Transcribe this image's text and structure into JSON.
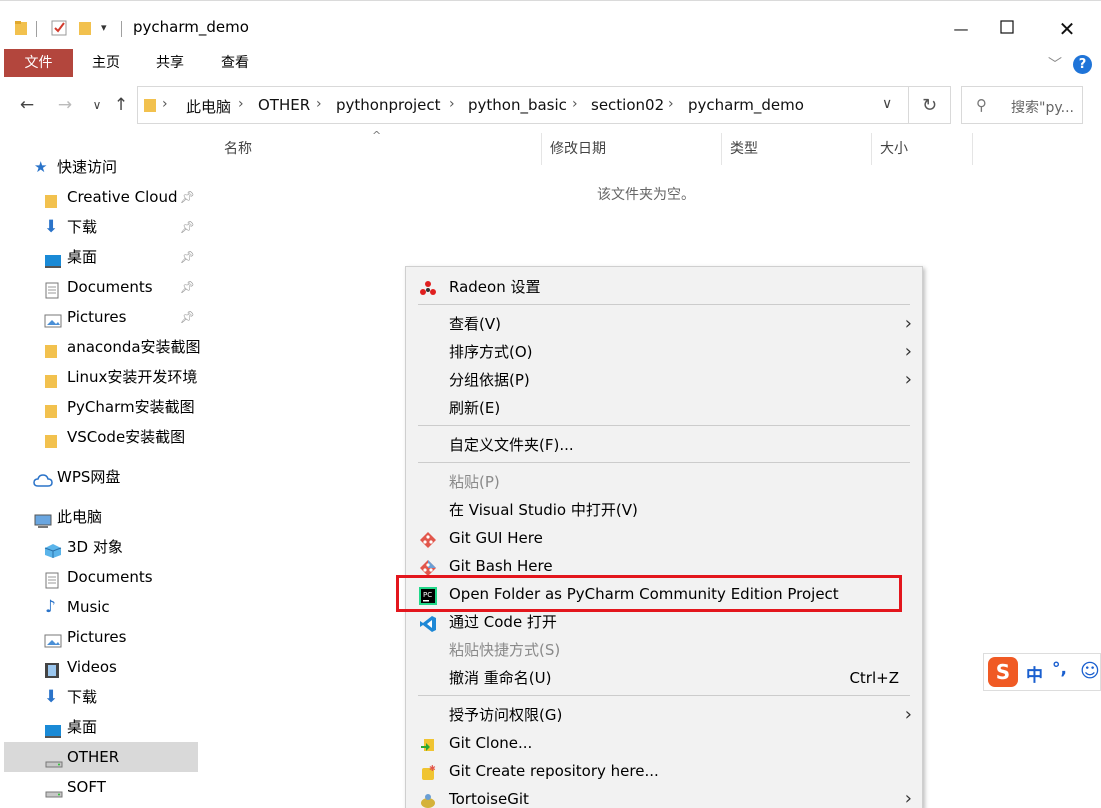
{
  "window": {
    "title": "pycharm_demo",
    "minimize_icon": "minimize-icon",
    "maximize_icon": "maximize-icon",
    "close_icon": "close-icon"
  },
  "ribbon": {
    "tabs": [
      "文件",
      "主页",
      "共享",
      "查看"
    ],
    "help_icon": "help-icon",
    "expand_icon": "chevron-down-icon"
  },
  "address": {
    "breadcrumbs": [
      "此电脑",
      "OTHER",
      "pythonproject",
      "python_basic",
      "section02",
      "pycharm_demo"
    ],
    "search_placeholder": "搜索\"py..."
  },
  "columns": [
    "名称",
    "修改日期",
    "类型",
    "大小"
  ],
  "empty_message": "该文件夹为空。",
  "sidebar": {
    "quick_access": "快速访问",
    "quick_items": [
      "Creative Cloud",
      "下载",
      "桌面",
      "Documents",
      "Pictures",
      "anaconda安装截图",
      "Linux安装开发环境",
      "PyCharm安装截图",
      "VSCode安装截图"
    ],
    "wps": "WPS网盘",
    "this_pc": "此电脑",
    "pc_items": [
      "3D 对象",
      "Documents",
      "Music",
      "Pictures",
      "Videos",
      "下载",
      "桌面",
      "OTHER",
      "SOFT"
    ]
  },
  "context_menu": {
    "radeon": "Radeon 设置",
    "view": "查看(V)",
    "sort": "排序方式(O)",
    "group": "分组依据(P)",
    "refresh": "刷新(E)",
    "customize": "自定义文件夹(F)...",
    "paste": "粘贴(P)",
    "open_vs": "在 Visual Studio 中打开(V)",
    "git_gui": "Git GUI Here",
    "git_bash": "Git Bash Here",
    "pycharm": "Open Folder as PyCharm Community Edition Project",
    "vscode": "通过 Code 打开",
    "paste_shortcut": "粘贴快捷方式(S)",
    "undo": "撤消 重命名(U)",
    "undo_accel": "Ctrl+Z",
    "grant": "授予访问权限(G)",
    "git_clone": "Git Clone...",
    "git_create": "Git Create repository here...",
    "tortoise": "TortoiseGit"
  },
  "ime": {
    "mode": "中",
    "punct": "°,"
  },
  "colors": {
    "file_tab": "#b3463d",
    "highlight_box": "#e3161d",
    "folder": "#f2c14e"
  }
}
